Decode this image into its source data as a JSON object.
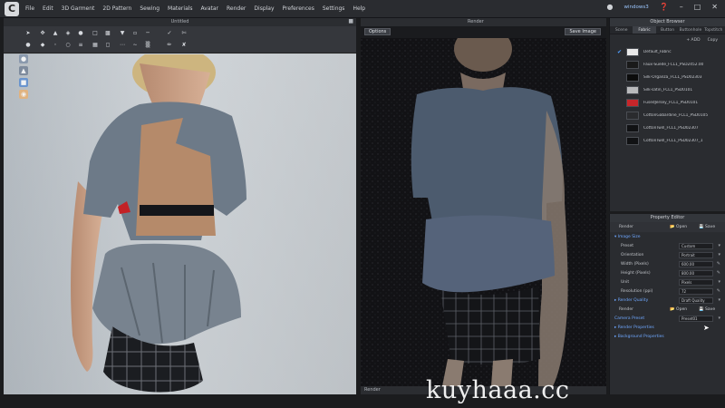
{
  "menubar": {
    "items": [
      "File",
      "Edit",
      "3D Garment",
      "2D Pattern",
      "Sewing",
      "Materials",
      "Avatar",
      "Render",
      "Display",
      "Preferences",
      "Settings",
      "Help"
    ],
    "user": "windows3"
  },
  "pane3d": {
    "title": "Untitled"
  },
  "render": {
    "title": "Render",
    "options_label": "Options",
    "save_label": "Save Image",
    "footer": "Render"
  },
  "object_browser": {
    "title": "Object Browser",
    "tabs": [
      "Scene",
      "Fabric",
      "Button",
      "Buttonhole",
      "Topstitch"
    ],
    "add_label": "+ ADD",
    "copy_label": "Copy",
    "fabrics": [
      {
        "name": "Default_Fabric",
        "color": "#e8e8e8",
        "checked": true
      },
      {
        "name": "Faux-Suede_FCL1_PSD2452.00",
        "color": "#1a1a1a",
        "checked": false
      },
      {
        "name": "Silk-Organza_FCL1_PSD02303",
        "color": "#0c0c0c",
        "checked": false
      },
      {
        "name": "Silk-satin_FCL1_PSD0101",
        "color": "#b9babc",
        "checked": false
      },
      {
        "name": "FusedJersey_FCL1_PSD0101",
        "color": "#c7262a",
        "checked": false
      },
      {
        "name": "CottonGabardine_FCL1_PSD0105",
        "color": "#2a2b2e",
        "checked": false
      },
      {
        "name": "CottonTwill_FCL1_PSD02307",
        "color": "#111214",
        "checked": false
      },
      {
        "name": "CottonTwill_FCL1_PSD02307_1",
        "color": "#111214",
        "checked": false
      }
    ]
  },
  "property_editor": {
    "title": "Property Editor",
    "header_label": "Render",
    "open_label": "Open",
    "save_label": "Save",
    "section_image_size": "Image Size",
    "rows": [
      {
        "label": "Preset",
        "value": "Custom"
      },
      {
        "label": "Orientation",
        "value": "Portrait"
      },
      {
        "label": "Width (Pixels)",
        "value": "600.00"
      },
      {
        "label": "Height (Pixels)",
        "value": "800.00"
      },
      {
        "label": "Unit",
        "value": "Pixels"
      },
      {
        "label": "Resolution (ppi)",
        "value": "72"
      }
    ],
    "render_quality_label": "Render Quality",
    "render_quality_value": "Draft Quality",
    "render_label": "Render",
    "camera_preset_label": "Camera Preset",
    "camera_preset_value": "Preset01",
    "render_properties_label": "Render Properties",
    "background_properties_label": "Background Properties"
  },
  "watermark": "kuyhaaa.cc",
  "colors": {
    "accent": "#4f9fff",
    "panel": "#2a2c30",
    "menubar": "#2a2c30"
  }
}
